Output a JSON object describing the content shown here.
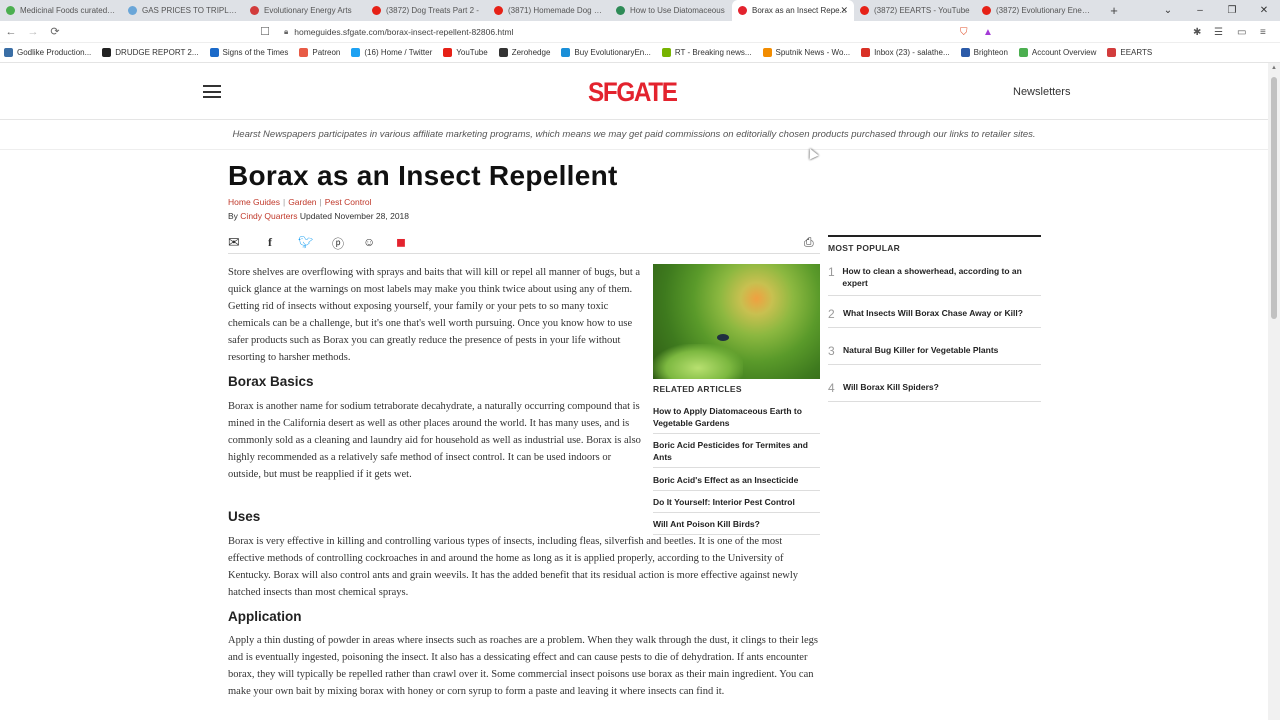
{
  "browser": {
    "tabs": [
      {
        "title": "Medicinal Foods curated by...",
        "color": "#4caf50"
      },
      {
        "title": "GAS PRICES TO TRIPLE?!",
        "color": "#6aa6d8"
      },
      {
        "title": "Evolutionary Energy Arts",
        "color": "#d23c3c"
      },
      {
        "title": "(3872) Dog Treats Part 2 -",
        "color": "#e62117"
      },
      {
        "title": "(3871) Homemade Dog Su...",
        "color": "#e62117"
      },
      {
        "title": "How to Use Diatomaceous",
        "color": "#2e8b57"
      },
      {
        "title": "Borax as an Insect Repe...",
        "color": "#e3232e"
      },
      {
        "title": "(3872) EEARTS - YouTube",
        "color": "#e62117"
      },
      {
        "title": "(3872) Evolutionary Energ...",
        "color": "#e62117"
      }
    ],
    "active_tab_index": 6,
    "new_tab": "+",
    "url": "homeguides.sfgate.com/borax-insect-repellent-82806.html",
    "window_controls": {
      "chevron": "⌄",
      "minimize": "–",
      "maximize": "❐",
      "close": "✕"
    }
  },
  "bookmarks": [
    {
      "label": "Godlike Production...",
      "color": "#3a6ea5"
    },
    {
      "label": "DRUDGE REPORT 2...",
      "color": "#222222"
    },
    {
      "label": "Signs of the Times",
      "color": "#1b6ac9"
    },
    {
      "label": "Patreon",
      "color": "#e85b46"
    },
    {
      "label": "(16) Home / Twitter",
      "color": "#1da1f2"
    },
    {
      "label": "YouTube",
      "color": "#e62117"
    },
    {
      "label": "Zerohedge",
      "color": "#333333"
    },
    {
      "label": "Buy EvolutionaryEn...",
      "color": "#1a8fd8"
    },
    {
      "label": "RT - Breaking news...",
      "color": "#77b300"
    },
    {
      "label": "Sputnik News - Wo...",
      "color": "#f28c00"
    },
    {
      "label": "Inbox (23) - salathe...",
      "color": "#d93025"
    },
    {
      "label": "Brighteon",
      "color": "#2b5aa8"
    },
    {
      "label": "Account Overview",
      "color": "#4caf50"
    },
    {
      "label": "EEARTS",
      "color": "#d23c3c"
    }
  ],
  "site": {
    "logo": "SFGATE",
    "newsletters": "Newsletters",
    "disclaimer": "Hearst Newspapers participates in various affiliate marketing programs, which means we may get paid commissions on editorially chosen products purchased through our links to retailer sites."
  },
  "article": {
    "title": "Borax as an Insect Repellent",
    "breadcrumbs": [
      "Home Guides",
      "Garden",
      "Pest Control"
    ],
    "byline_prefix": "By",
    "author": "Cindy Quarters",
    "updated": "Updated November 28, 2018",
    "intro": "Store shelves are overflowing with sprays and baits that will kill or repel all manner of bugs, but a quick glance at the warnings on most labels may make you think twice about using any of them. Getting rid of insects without exposing yourself, your family or your pets to so many toxic chemicals can be a challenge, but it's one that's well worth pursuing. Once you know how to use safer products such as Borax you can greatly reduce the presence of pests in your life without resorting to harsher methods.",
    "sections": [
      {
        "heading": "Borax Basics",
        "text": "Borax is another name for sodium tetraborate decahydrate, a naturally occurring compound that is mined in the California desert as well as other places around the world. It has many uses, and is commonly sold as a cleaning and laundry aid for household as well as industrial use. Borax is also highly recommended as a relatively safe method of insect control. It can be used indoors or outside, but must be reapplied if it gets wet."
      },
      {
        "heading": "Uses",
        "text": "Borax is very effective in killing and controlling various types of insects, including fleas, silverfish and beetles. It is one of the most effective methods of controlling cockroaches in and around the home as long as it is applied properly, according to the University of Kentucky. Borax will also control ants and grain weevils. It has the added benefit that its residual action is more effective against newly hatched insects than most chemical sprays."
      },
      {
        "heading": "Application",
        "text": "Apply a thin dusting of powder in areas where insects such as roaches are a problem. When they walk through the dust, it clings to their legs and is eventually ingested, poisoning the insect. It also has a dessicating effect and can cause pests to die of dehydration. If ants encounter borax, they will typically be repelled rather than crawl over it. Some commercial insect poisons use borax as their main ingredient. You can make your own bait by mixing borax with honey or corn syrup to form a paste and leaving it where insects can find it."
      }
    ]
  },
  "related": {
    "label": "RELATED ARTICLES",
    "items": [
      "How to Apply Diatomaceous Earth to Vegetable Gardens",
      "Boric Acid Pesticides for Termites and Ants",
      "Boric Acid's Effect as an Insecticide",
      "Do It Yourself: Interior Pest Control",
      "Will Ant Poison Kill Birds?"
    ]
  },
  "popular": {
    "label": "MOST POPULAR",
    "items": [
      {
        "num": "1",
        "title": "How to clean a showerhead, according to an expert"
      },
      {
        "num": "2",
        "title": "What Insects Will Borax Chase Away or Kill?"
      },
      {
        "num": "3",
        "title": "Natural Bug Killer for Vegetable Plants"
      },
      {
        "num": "4",
        "title": "Will Borax Kill Spiders?"
      }
    ]
  },
  "colors": {
    "brand": "#e3232e",
    "link": "#c0392b"
  }
}
